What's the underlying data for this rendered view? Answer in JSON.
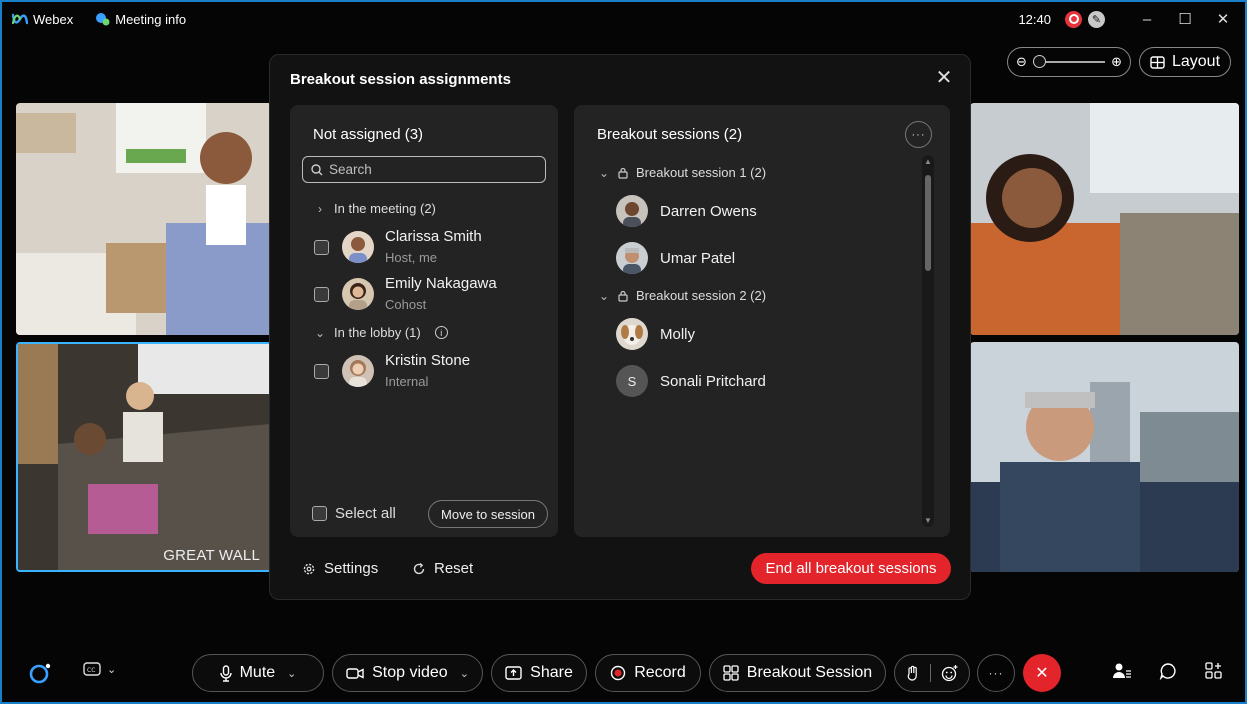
{
  "titlebar": {
    "app_name": "Webex",
    "meeting_info": "Meeting info",
    "time": "12:40",
    "sync_glyph": "✎",
    "minimize": "–",
    "maximize": "☐",
    "close": "✕"
  },
  "view": {
    "zoom_minus": "⊖",
    "zoom_plus": "⊕",
    "layout_label": "Layout"
  },
  "tiles": {
    "room_label": "GREAT WALL"
  },
  "modal": {
    "title": "Breakout session assignments",
    "close": "✕",
    "not_assigned": {
      "heading": "Not assigned (3)",
      "search_placeholder": "Search",
      "in_meeting_label": "In the meeting (2)",
      "in_lobby_label": "In the lobby (1)",
      "people": [
        {
          "name": "Clarissa Smith",
          "role": "Host, me"
        },
        {
          "name": "Emily Nakagawa",
          "role": "Cohost"
        },
        {
          "name": "Kristin Stone",
          "role": "Internal"
        }
      ],
      "select_all": "Select all",
      "move_button": "Move to session"
    },
    "sessions": {
      "heading": "Breakout sessions (2)",
      "more": "···",
      "list": [
        {
          "name": "Breakout session 1 (2)",
          "members": [
            "Darren Owens",
            "Umar Patel"
          ]
        },
        {
          "name": "Breakout session 2 (2)",
          "members": [
            "Molly",
            "Sonali Pritchard"
          ]
        }
      ],
      "sonali_initial": "S"
    },
    "footer": {
      "settings": "Settings",
      "reset": "Reset",
      "end_all": "End all breakout sessions"
    }
  },
  "toolbar": {
    "mute": "Mute",
    "stop_video": "Stop video",
    "share": "Share",
    "record": "Record",
    "breakout": "Breakout Session",
    "more": "···",
    "leave": "✕"
  },
  "colors": {
    "accent_blue": "#1a7fc9",
    "danger_red": "#e3242b",
    "panel_bg": "#232323",
    "modal_bg": "#121212"
  }
}
